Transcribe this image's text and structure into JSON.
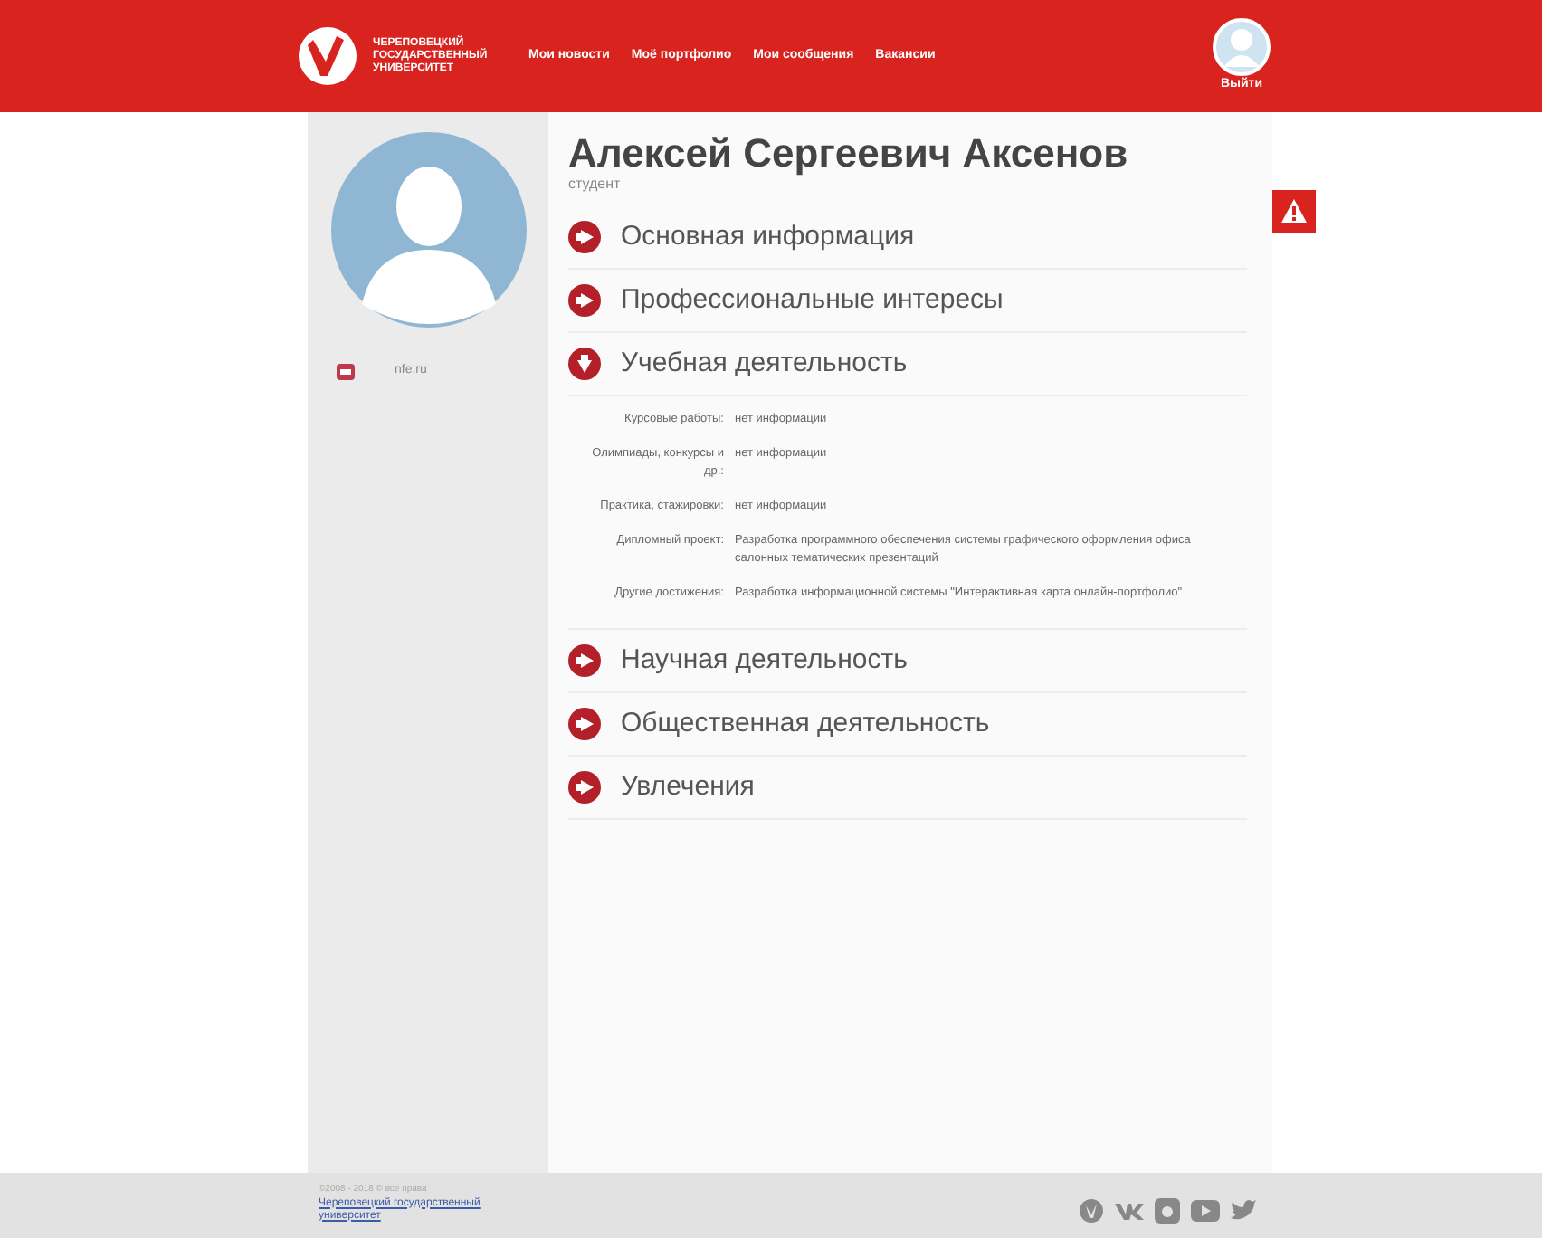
{
  "header": {
    "logo_text": "ЧЕРЕПОВЕЦКИЙ ГОСУДАРСТВЕННЫЙ УНИВЕРСИТЕТ",
    "nav": [
      {
        "label": "Мои новости"
      },
      {
        "label": "Моё портфолио"
      },
      {
        "label": "Мои сообщения"
      },
      {
        "label": "Вакансии"
      }
    ],
    "user_label": "Выйти"
  },
  "sidebar": {
    "contact": "nfe.ru"
  },
  "profile": {
    "name": "Алексей Сергеевич Аксенов",
    "role": "студент"
  },
  "sections": [
    {
      "title": "Основная информация",
      "expanded": false
    },
    {
      "title": "Профессиональные интересы",
      "expanded": false
    },
    {
      "title": "Учебная деятельность",
      "expanded": true,
      "fields": [
        {
          "label": "Курсовые работы:",
          "value": "нет информации"
        },
        {
          "label": "Олимпиады, конкурсы и др.:",
          "value": "нет информации"
        },
        {
          "label": "Практика, стажировки:",
          "value": "нет информации"
        },
        {
          "label": "Дипломный проект:",
          "value": "Разработка программного обеспечения системы графического оформления офиса салонных тематических презентаций"
        },
        {
          "label": "Другие достижения:",
          "value": "Разработка информационной системы \"Интерактивная карта онлайн-портфолио\""
        }
      ]
    },
    {
      "title": "Научная деятельность",
      "expanded": false
    },
    {
      "title": "Общественная деятельность",
      "expanded": false
    },
    {
      "title": "Увлечения",
      "expanded": false
    }
  ],
  "footer": {
    "copyright": "©2008 - 2018 © все права",
    "link": "Череповецкий государственный университет"
  }
}
